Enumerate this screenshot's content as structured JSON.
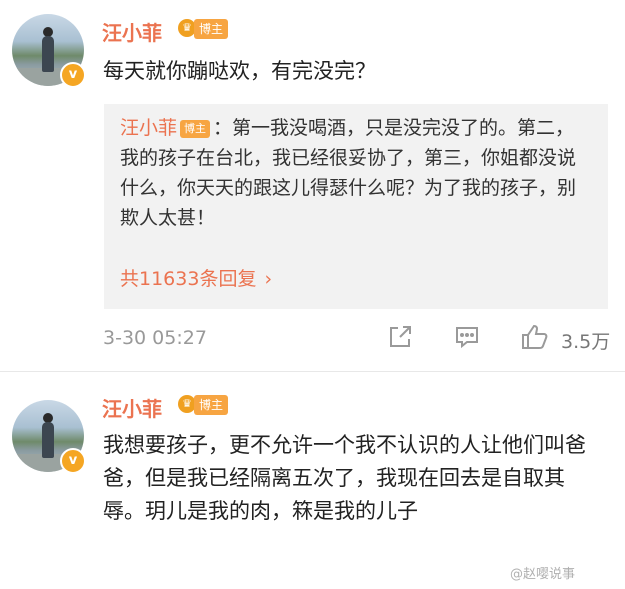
{
  "comments": [
    {
      "username": "汪小菲",
      "badge": "博主",
      "verified_mark": "v",
      "text": "每天就你蹦哒欢，有完没完？",
      "quote": {
        "username": "汪小菲",
        "badge": "博主",
        "text": "：第一我没喝酒，只是没完没了的。第二，我的孩子在台北，我已经很妥协了，第三，你姐都没说什么，你天天的跟这儿得瑟什么呢？为了我的孩子，别欺人太甚！",
        "replies_link": "共11633条回复",
        "chevron": "›"
      },
      "timestamp": "3-30 05:27",
      "likes": "3.5万",
      "icons": [
        "share-icon",
        "comment-icon",
        "like-icon"
      ]
    },
    {
      "username": "汪小菲",
      "badge": "博主",
      "verified_mark": "v",
      "text": "我想要孩子，更不允许一个我不认识的人让他们叫爸爸，但是我已经隔离五次了，我现在回去是自取其辱。玥儿是我的肉，箖是我的儿子"
    }
  ],
  "watermark": "@赵嘤说事",
  "colors": {
    "username": "#eb7350",
    "badge": "#f7a542",
    "quote_bg": "#f2f2f2",
    "meta_text": "#999999"
  }
}
